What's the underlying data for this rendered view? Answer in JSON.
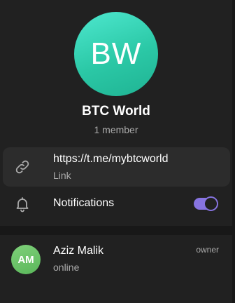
{
  "chat": {
    "avatar_initials": "BW",
    "title": "BTC World",
    "subtitle": "1 member"
  },
  "info": {
    "link": {
      "value": "https://t.me/mybtcworld",
      "caption": "Link",
      "icon": "link-icon"
    },
    "notifications": {
      "label": "Notifications",
      "enabled": true,
      "icon": "bell-icon"
    }
  },
  "members": [
    {
      "initials": "AM",
      "name": "Aziz Malik",
      "status": "online",
      "role": "owner"
    }
  ],
  "colors": {
    "background": "#212121",
    "accent": "#8774e1",
    "chat_avatar": "#2bc8a6",
    "member_avatar": "#5ab75a"
  }
}
